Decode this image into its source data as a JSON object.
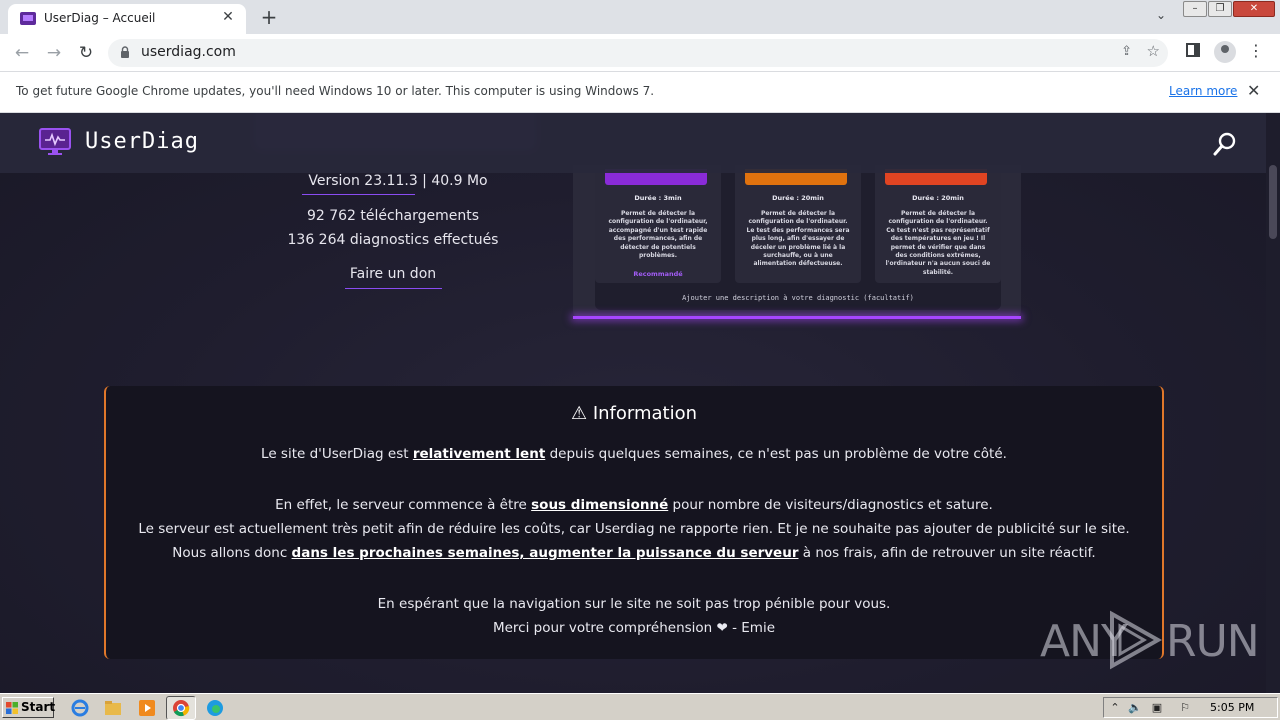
{
  "browser": {
    "tab_title": "UserDiag – Accueil",
    "tab_close": "✕",
    "new_tab": "+",
    "url": "userdiag.com",
    "infobar_text": "To get future Google Chrome updates, you'll need Windows 10 or later. This computer is using Windows 7.",
    "infobar_link": "Learn more",
    "infobar_close": "✕"
  },
  "site": {
    "brand": "UserDiag",
    "version": "Version 23.11.3  |  40.9 Mo",
    "downloads": "92 762 téléchargements",
    "diagnostics": "136 264 diagnostics effectués",
    "donate": "Faire un don",
    "preview": {
      "cards": [
        {
          "duration": "Durée : 3min",
          "description": "Permet de détecter la configuration de l'ordinateur, accompagné d'un test rapide des performances, afin de détecter de potentiels problèmes.",
          "badge": "Recommandé",
          "color": "#8a2bd8"
        },
        {
          "duration": "Durée : 20min",
          "description": "Permet de détecter la configuration de l'ordinateur. Le test des performances sera plus long, afin d'essayer de déceler un problème lié à la surchauffe, ou à une alimentation défectueuse.",
          "color": "#e0720e"
        },
        {
          "duration": "Durée : 20min",
          "description": "Permet de détecter la configuration de l'ordinateur. Ce test n'est pas représentatif des températures en jeu ! Il permet de vérifier que dans des conditions extrêmes, l'ordinateur n'a aucun souci de stabilité.",
          "color": "#e04422"
        }
      ],
      "footer": "Ajouter une description à votre diagnostic (facultatif)"
    },
    "information": {
      "title": "⚠ Information",
      "line1_pre": "Le site d'UserDiag est ",
      "line1_em": "relativement lent",
      "line1_post": " depuis quelques semaines, ce n'est pas un problème de votre côté.",
      "line2_pre": "En effet, le serveur commence à être ",
      "line2_em": "sous dimensionné",
      "line2_post": " pour nombre de visiteurs/diagnostics et sature.",
      "line3": "Le serveur est actuellement très petit afin de réduire les coûts, car Userdiag ne rapporte rien. Et je ne souhaite pas ajouter de publicité sur le site.",
      "line4_pre": "Nous allons donc ",
      "line4_em": "dans les prochaines semaines, augmenter la puissance du serveur",
      "line4_post": " à nos frais, afin de retrouver un site réactif.",
      "line5": "En espérant que la navigation sur le site ne soit pas trop pénible pour vous.",
      "line6": "Merci pour votre compréhension ❤ - Emie"
    }
  },
  "watermark": {
    "left": "ANY",
    "right": "RUN"
  },
  "taskbar": {
    "start_label": "Start",
    "clock": "5:05 PM"
  },
  "colors": {
    "accent": "#8a4cf2",
    "info_border": "#e0772a",
    "page_bg": "#1c1b2b"
  }
}
